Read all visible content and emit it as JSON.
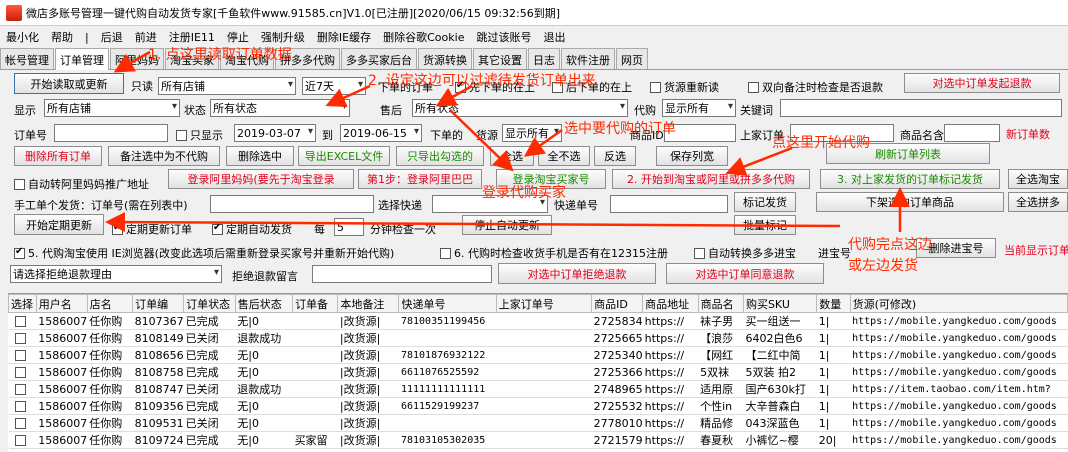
{
  "window": {
    "title": "微店多账号管理一键代购自动发货专家[千鱼软件www.91585.cn]V1.0[已注册][2020/06/15 09:32:56到期]"
  },
  "menu": [
    "最小化",
    "帮助",
    "|",
    "后退",
    "前进",
    "注册IE11",
    "停止",
    "强制升级",
    "删除IE缓存",
    "删除谷歌Cookie",
    "跳过该账号",
    "退出"
  ],
  "tabs": [
    "帐号管理",
    "订单管理",
    "阿里妈妈",
    "淘宝买家",
    "淘宝代购",
    "拼多多代购",
    "多多买家后台",
    "货源转换",
    "其它设置",
    "日志",
    "软件注册",
    "网页"
  ],
  "row1": {
    "start_read_btn": "开始读取或更新",
    "readonly_label": "只读",
    "shop_select": "所有店铺",
    "days_select": "近7天",
    "order_first_label": "下单的订单",
    "first_order_label": "先下单的在上",
    "later_order_label": "后下单的在上",
    "resource_reread_label": "货源重新读",
    "double_remark_label": "双向备注时检查是否退款",
    "refund_selected_btn": "对选中订单发起退款"
  },
  "row2": {
    "show_label": "显示",
    "show_select": "所有店铺",
    "status_label": "状态",
    "status_select": "所有状态",
    "aftersale_label": "售后",
    "aftersale_select": "所有状态",
    "proxy_label": "代购",
    "proxy_select": "显示所有",
    "keyword_label": "关键词",
    "keyword_value": ""
  },
  "row3": {
    "order_no_label": "订单号",
    "only_show_label": "只显示",
    "date_from": "2019-03-07",
    "to_label": "到",
    "date_to": "2019-06-15",
    "placed_label": "下单的",
    "source_label": "货源",
    "source_select": "显示所有",
    "product_id_label": "商品ID",
    "buyer_order_label": "上家订单",
    "product_name_label": "商品名含",
    "new_count_label": "新订单数"
  },
  "row4": {
    "delete_all": "删除所有订单",
    "remark_no_proxy": "备注选中为不代购",
    "delete_selected": "删除选中",
    "export_excel": "导出EXCEL文件",
    "export_checked": "只导出勾选的",
    "select_all": "全选",
    "deselect_all": "全不选",
    "invert": "反选",
    "save_width": "保存列宽",
    "refresh_list": "刷新订单列表"
  },
  "row5": {
    "auto_alimama_label": "自动转阿里妈妈推广地址",
    "login_alimama": "登录阿里妈妈(要先于淘宝登录",
    "login_alibaba": "第1步：登录阿里巴巴",
    "login_taobao_buyer": "登录淘宝买家号",
    "start_proxy": "2. 开始到淘宝或阿里或拼多多代购",
    "mark_shipped": "3. 对上家发货的订单标记发货",
    "select_taobao_btn": "全选淘宝"
  },
  "row6": {
    "manual_label": "手工单个发货：订单号(需在列表中)",
    "select_express_label": "选择快递",
    "tracking_no_label": "快递单号",
    "mark_ship_btn": "标记发货",
    "offshelf_btn": "下架选中订单商品",
    "select_pdd_btn": "全选拼多"
  },
  "row7": {
    "start_timer_btn": "开始定期更新",
    "timer_update_label": "定期更新订单",
    "timer_ship_label": "定期自动发货",
    "every_label": "每",
    "every_value": "5",
    "minutes_label": "分钟检查一次",
    "stop_auto_btn": "停止自动更新",
    "batch_mark_btn": "批量标记"
  },
  "row8": {
    "ie_label": "5. 代购淘宝使用 IE浏览器(改变此选项后需重新登录买家号并重新开始代购)",
    "phone_check_label": "6. 代购时检查收货手机是否有在12315注册",
    "auto_pdd_label": "自动转换多多进宝",
    "jinbao_label": "进宝号",
    "delete_jinbao_btn": "删除进宝号",
    "current_show_label": "当前显示订单"
  },
  "row9": {
    "reject_reason_select": "请选择拒绝退款理由",
    "reject_msg_label": "拒绝退款留言",
    "reject_selected_btn": "对选中订单拒绝退款",
    "agree_selected_btn": "对选中订单同意退款"
  },
  "annotations": {
    "a1": "1. 点这里读取订单数据",
    "a2": "2. 设定这边可以过滤待发货订单出来",
    "a3": "选中要代购的订单",
    "a4": "点这里开始代购",
    "a5": "登录代购买家",
    "a6": "代购完点这边",
    "a7": "或左边发货"
  },
  "table": {
    "columns": [
      "选择",
      "用户名",
      "店名",
      "订单编",
      "订单状态",
      "售后状态",
      "订单备",
      "本地备注",
      "快递单号",
      "上家订单号",
      "商品ID",
      "商品地址",
      "商品名",
      "购买SKU",
      "数量",
      "货源(可修改)"
    ],
    "rows": [
      [
        "",
        "1586007",
        "任你购",
        "8107367",
        "已完成",
        "无|0",
        "",
        "|改货源|",
        "78100351199456",
        "",
        "2725834",
        "https://",
        "袜子男",
        "买一组送一",
        "1|",
        "https://mobile.yangkeduo.com/goods"
      ],
      [
        "",
        "1586007",
        "任你购",
        "8108149",
        "已关闭",
        "退款成功",
        "",
        "|改货源|",
        "",
        "",
        "2725665",
        "https://",
        "【浪莎",
        "6402白色6",
        "1|",
        "https://mobile.yangkeduo.com/goods"
      ],
      [
        "",
        "1586007",
        "任你购",
        "8108656",
        "已完成",
        "无|0",
        "",
        "|改货源|",
        "78101876932122",
        "",
        "2725340",
        "https://",
        "【网红",
        "【二红中简",
        "1|",
        "https://mobile.yangkeduo.com/goods"
      ],
      [
        "",
        "1586007",
        "任你购",
        "8108758",
        "已完成",
        "无|0",
        "",
        "|改货源|",
        "6611076525592",
        "",
        "2725366",
        "https://",
        "5双袜",
        "5双装 拍2",
        "1|",
        "https://mobile.yangkeduo.com/goods"
      ],
      [
        "",
        "1586007",
        "任你购",
        "8108747",
        "已关闭",
        "退款成功",
        "",
        "|改货源|",
        "11111111111111",
        "",
        "2748965",
        "https://",
        "适用原",
        "国产630k打",
        "1|",
        "https://item.taobao.com/item.htm?"
      ],
      [
        "",
        "1586007",
        "任你购",
        "8109356",
        "已完成",
        "无|0",
        "",
        "|改货源|",
        "6611529199237",
        "",
        "2725532",
        "https://",
        "个性in",
        "大辛普森白",
        "1|",
        "https://mobile.yangkeduo.com/goods"
      ],
      [
        "",
        "1586007",
        "任你购",
        "8109531",
        "已关闭",
        "无|0",
        "",
        "|改货源|",
        "",
        "",
        "2778010",
        "https://",
        "精品修",
        "043深蓝色",
        "1|",
        "https://mobile.yangkeduo.com/goods"
      ],
      [
        "",
        "1586007",
        "任你购",
        "8109724",
        "已完成",
        "无|0",
        "买家留",
        "|改货源|",
        "78103105302035",
        "",
        "2721579",
        "https://",
        "春夏秋",
        "小裤忆~樱",
        "20|",
        "https://mobile.yangkeduo.com/goods"
      ]
    ]
  },
  "colors": {
    "red": "#e1001c",
    "green": "#1c8a00",
    "annotation": "#ff2a00"
  }
}
